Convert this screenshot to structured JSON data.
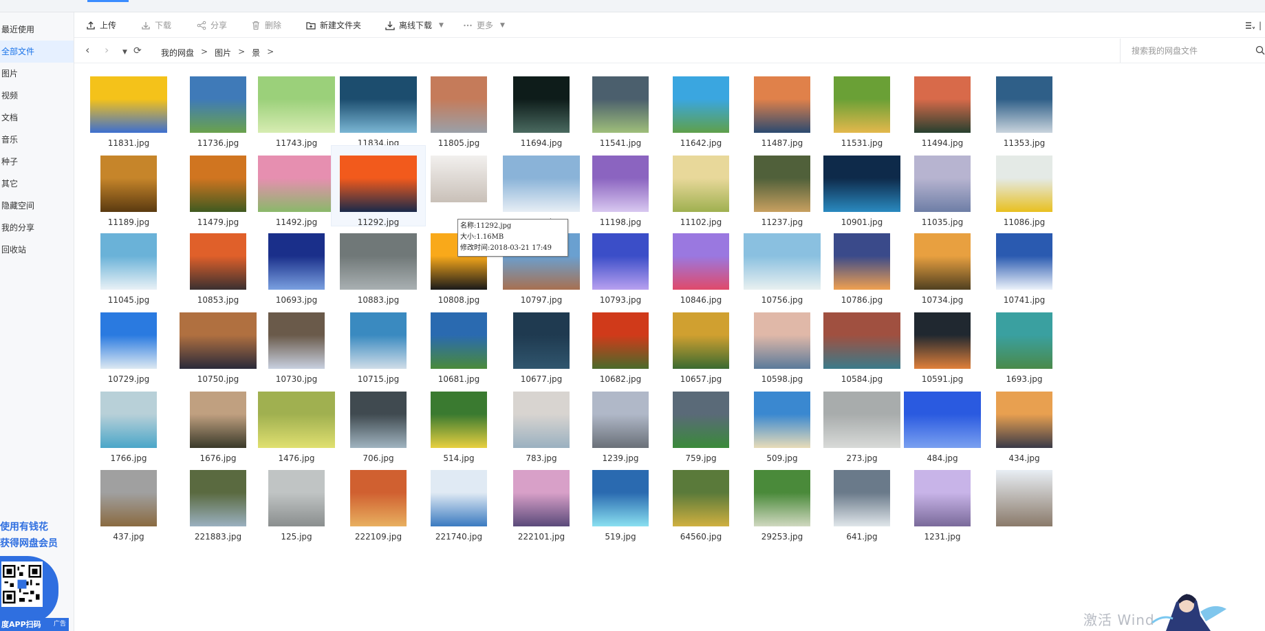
{
  "sidebar": {
    "items": [
      {
        "label": "最近使用",
        "active": false
      },
      {
        "label": "全部文件",
        "active": true
      },
      {
        "label": "图片",
        "active": false
      },
      {
        "label": "视频",
        "active": false
      },
      {
        "label": "文档",
        "active": false
      },
      {
        "label": "音乐",
        "active": false
      },
      {
        "label": "种子",
        "active": false
      },
      {
        "label": "其它",
        "active": false
      },
      {
        "label": "隐藏空间",
        "active": false
      },
      {
        "label": "我的分享",
        "active": false
      },
      {
        "label": "回收站",
        "active": false
      }
    ],
    "promo": {
      "line1": "使用有钱花",
      "line2": "获得网盘会员",
      "scan": "度APP扫码",
      "ad": "广告"
    }
  },
  "toolbar": {
    "upload": "上传",
    "download": "下载",
    "share": "分享",
    "delete": "删除",
    "new_folder": "新建文件夹",
    "offline": "离线下载",
    "more": "更多"
  },
  "address": {
    "crumbs": [
      "我的网盘",
      "图片",
      "景"
    ],
    "search_placeholder": "搜索我的网盘文件"
  },
  "files": [
    [
      "11831.jpg",
      "11736.jpg",
      "11743.jpg",
      "11834.jpg",
      "11805.jpg",
      "11694.jpg",
      "11541.jpg",
      "11642.jpg",
      "11487.jpg",
      "11531.jpg",
      "11494.jpg",
      "11353.jpg"
    ],
    [
      "11189.jpg",
      "11479.jpg",
      "11492.jpg",
      "11292.jpg",
      "",
      "11396.jpg",
      "11198.jpg",
      "11102.jpg",
      "11237.jpg",
      "10901.jpg",
      "11035.jpg",
      "11086.jpg"
    ],
    [
      "11045.jpg",
      "10853.jpg",
      "10693.jpg",
      "10883.jpg",
      "10808.jpg",
      "10797.jpg",
      "10793.jpg",
      "10846.jpg",
      "10756.jpg",
      "10786.jpg",
      "10734.jpg",
      "10741.jpg"
    ],
    [
      "10729.jpg",
      "10750.jpg",
      "10730.jpg",
      "10715.jpg",
      "10681.jpg",
      "10677.jpg",
      "10682.jpg",
      "10657.jpg",
      "10598.jpg",
      "10584.jpg",
      "10591.jpg",
      "1693.jpg"
    ],
    [
      "1766.jpg",
      "1676.jpg",
      "1476.jpg",
      "706.jpg",
      "514.jpg",
      "783.jpg",
      "1239.jpg",
      "759.jpg",
      "509.jpg",
      "273.jpg",
      "484.jpg",
      "434.jpg"
    ],
    [
      "437.jpg",
      "221883.jpg",
      "125.jpg",
      "222109.jpg",
      "221740.jpg",
      "222101.jpg",
      "519.jpg",
      "64560.jpg",
      "29253.jpg",
      "641.jpg",
      "1231.jpg",
      ""
    ]
  ],
  "tooltip": {
    "name": "名称:11292.jpg",
    "size": "大小:1.16MB",
    "modified": "修改时间:2018-03-21 17:49"
  },
  "watermark": "激活 Wind",
  "colors": {
    "accent": "#1a73e8",
    "promo": "#2f6fe0",
    "active_bg": "#e6f0ff"
  }
}
